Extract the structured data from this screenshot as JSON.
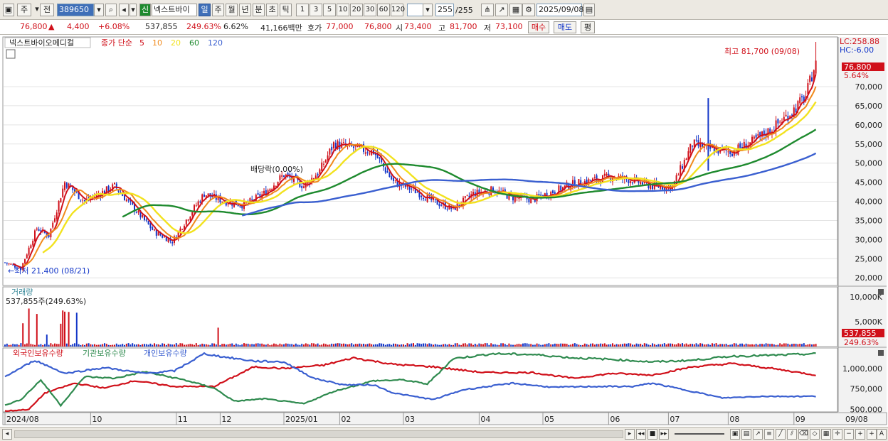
{
  "toolbar": {
    "period_jong": "주",
    "prev_label": "전",
    "code": "389650",
    "badge_sin": "신",
    "stock_name": "넥스트바이",
    "tabs": [
      "일",
      "주",
      "월",
      "년",
      "분",
      "초",
      "틱"
    ],
    "active_tab": "일",
    "intervals": [
      "1",
      "3",
      "5",
      "10",
      "20",
      "30",
      "60",
      "120"
    ],
    "count": "255",
    "count_total": "/255",
    "date": "2025/09/08"
  },
  "info": {
    "price": "76,800",
    "arrow": "▲",
    "change": "4,400",
    "change_pct": "+6.08%",
    "volume": "537,855",
    "vol_ratio": "249.63%",
    "turnover": "6.62%",
    "amount": "41,166백만",
    "ask_label": "호가",
    "ask_value": "77,000",
    "bid_value": "76,800",
    "open_label": "시",
    "open_value": "73,400",
    "high_label": "고",
    "high_value": "81,700",
    "low_label": "저",
    "low_value": "73,100",
    "buy_label": "매수",
    "sell_label": "매도",
    "avg_label": "평"
  },
  "colors": {
    "up": "#d0101a",
    "down": "#1437c8",
    "ma5": "#d0101a",
    "ma10": "#f08a1c",
    "ma20": "#f2e21e",
    "ma60": "#1e8a2e",
    "ma120": "#3a5fd0",
    "foreign": "#d0101a",
    "inst": "#2e8a4e",
    "indiv": "#3a5fd0"
  },
  "chart_data": [
    {
      "type": "candlestick",
      "title": "넥스트바이오메디컬",
      "legend": {
        "label": "종가 단순",
        "periods": [
          "5",
          "10",
          "20",
          "60",
          "120"
        ]
      },
      "y_ticks": [
        "70,000",
        "65,000",
        "60,000",
        "55,000",
        "50,000",
        "45,000",
        "40,000",
        "35,000",
        "30,000",
        "25,000",
        "20,000"
      ],
      "ylim": [
        18000,
        83000
      ],
      "annotations": {
        "high": "최고 81,700 (09/08)",
        "low": "←최저 21,400 (08/21)",
        "dividend": "배당락(0.00%)",
        "lc": "LC:258.88",
        "hc": "HC:-6.00",
        "current": "76,800",
        "current_pct": "5.64%"
      },
      "ohlc_keypoints": [
        [
          0,
          24000
        ],
        [
          8,
          22500
        ],
        [
          16,
          33000
        ],
        [
          22,
          31000
        ],
        [
          30,
          45000
        ],
        [
          40,
          40000
        ],
        [
          55,
          44000
        ],
        [
          65,
          38000
        ],
        [
          75,
          32000
        ],
        [
          84,
          29500
        ],
        [
          92,
          36000
        ],
        [
          100,
          42000
        ],
        [
          110,
          40000
        ],
        [
          120,
          39000
        ],
        [
          130,
          42000
        ],
        [
          140,
          47000
        ],
        [
          150,
          44000
        ],
        [
          158,
          48000
        ],
        [
          165,
          55000
        ],
        [
          175,
          54000
        ],
        [
          185,
          53000
        ],
        [
          195,
          45000
        ],
        [
          205,
          43000
        ],
        [
          215,
          40000
        ],
        [
          225,
          38000
        ],
        [
          235,
          42000
        ],
        [
          245,
          43000
        ],
        [
          255,
          41000
        ],
        [
          265,
          40500
        ],
        [
          275,
          42500
        ],
        [
          285,
          44500
        ],
        [
          295,
          45500
        ],
        [
          305,
          46500
        ],
        [
          315,
          45500
        ],
        [
          325,
          44000
        ],
        [
          335,
          43800
        ],
        [
          345,
          55000
        ],
        [
          355,
          53500
        ],
        [
          365,
          53000
        ],
        [
          375,
          55500
        ],
        [
          385,
          59000
        ],
        [
          395,
          63500
        ],
        [
          402,
          67500
        ],
        [
          407,
          76800
        ]
      ]
    },
    {
      "type": "bar",
      "title": "거래량",
      "label": "537,855주(249.63%)",
      "y_ticks": [
        "10,000K",
        "5,000K"
      ],
      "current": "537,855",
      "current_pct": "249.63%",
      "ylim": [
        0,
        12000000
      ]
    },
    {
      "type": "line",
      "legend": [
        "외국인보유수량",
        "기관보유수량",
        "개인보유수량"
      ],
      "y_ticks": [
        "1,000,000",
        "750,000",
        "500,000"
      ],
      "ylim": [
        470000,
        1250000
      ],
      "series": [
        {
          "name": "외국인보유수량",
          "keypoints": [
            [
              0,
              480000
            ],
            [
              12,
              500000
            ],
            [
              20,
              700000
            ],
            [
              35,
              820000
            ],
            [
              50,
              760000
            ],
            [
              65,
              850000
            ],
            [
              85,
              780000
            ],
            [
              105,
              780000
            ],
            [
              125,
              1020000
            ],
            [
              140,
              1000000
            ],
            [
              160,
              1040000
            ],
            [
              175,
              1130000
            ],
            [
              195,
              1050000
            ],
            [
              215,
              1020000
            ],
            [
              240,
              950000
            ],
            [
              265,
              950000
            ],
            [
              285,
              880000
            ],
            [
              305,
              940000
            ],
            [
              325,
              920000
            ],
            [
              345,
              1020000
            ],
            [
              365,
              1060000
            ],
            [
              385,
              1000000
            ],
            [
              407,
              920000
            ]
          ]
        },
        {
          "name": "기관보유수량",
          "keypoints": [
            [
              0,
              550000
            ],
            [
              8,
              620000
            ],
            [
              18,
              860000
            ],
            [
              28,
              550000
            ],
            [
              40,
              900000
            ],
            [
              55,
              880000
            ],
            [
              70,
              960000
            ],
            [
              90,
              860000
            ],
            [
              105,
              760000
            ],
            [
              115,
              600000
            ],
            [
              130,
              630000
            ],
            [
              150,
              570000
            ],
            [
              165,
              720000
            ],
            [
              185,
              850000
            ],
            [
              200,
              860000
            ],
            [
              212,
              810000
            ],
            [
              225,
              1120000
            ],
            [
              245,
              1180000
            ],
            [
              265,
              1170000
            ],
            [
              285,
              1130000
            ],
            [
              305,
              1110000
            ],
            [
              325,
              1080000
            ],
            [
              345,
              1100000
            ],
            [
              365,
              1150000
            ],
            [
              385,
              1160000
            ],
            [
              407,
              1180000
            ]
          ]
        },
        {
          "name": "개인보유수량",
          "keypoints": [
            [
              0,
              900000
            ],
            [
              15,
              1100000
            ],
            [
              30,
              940000
            ],
            [
              50,
              1010000
            ],
            [
              70,
              940000
            ],
            [
              85,
              970000
            ],
            [
              100,
              1180000
            ],
            [
              110,
              1140000
            ],
            [
              125,
              1090000
            ],
            [
              140,
              1080000
            ],
            [
              155,
              880000
            ],
            [
              170,
              800000
            ],
            [
              185,
              800000
            ],
            [
              195,
              700000
            ],
            [
              215,
              620000
            ],
            [
              230,
              740000
            ],
            [
              255,
              820000
            ],
            [
              275,
              770000
            ],
            [
              295,
              780000
            ],
            [
              315,
              780000
            ],
            [
              325,
              820000
            ],
            [
              345,
              720000
            ],
            [
              360,
              640000
            ],
            [
              380,
              660000
            ],
            [
              407,
              660000
            ]
          ]
        }
      ]
    }
  ],
  "x_axis": {
    "labels": [
      "2024/08",
      "10",
      "11",
      "12",
      "2025/01",
      "02",
      "03",
      "04",
      "05",
      "06",
      "07",
      "08",
      "09",
      "09/08"
    ]
  }
}
